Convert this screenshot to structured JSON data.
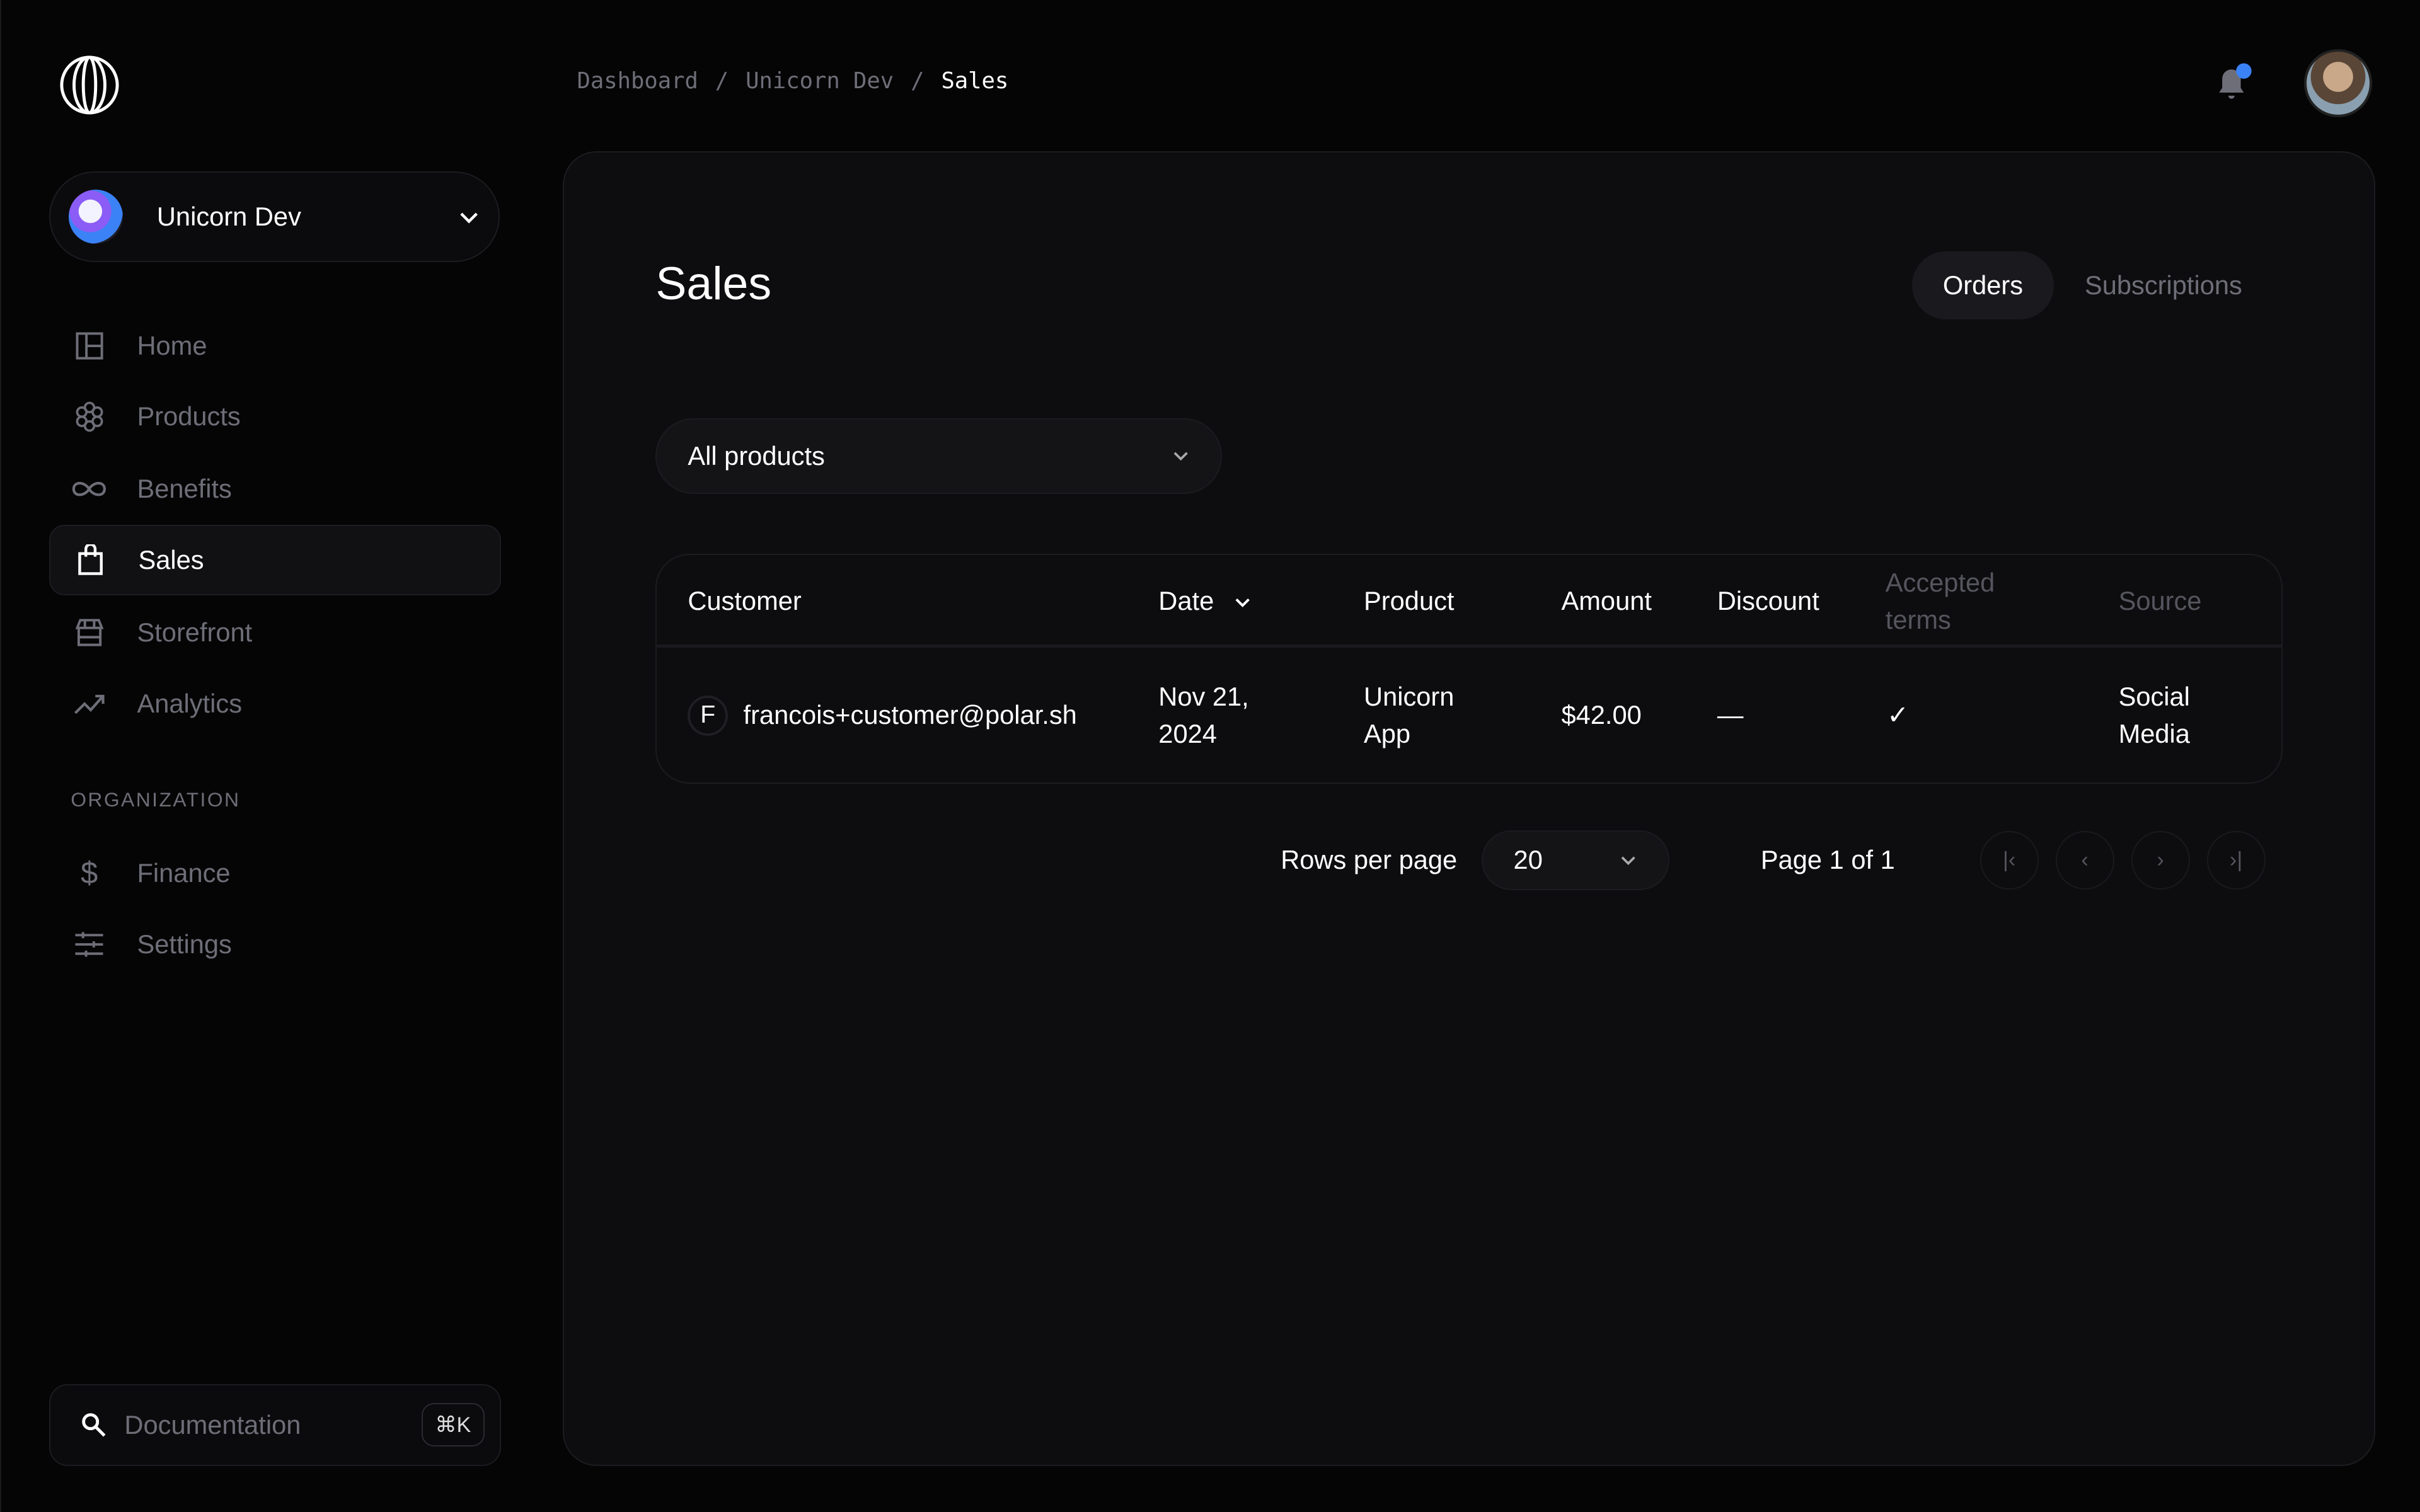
{
  "workspace": {
    "name": "Unicorn Dev"
  },
  "nav": [
    {
      "label": "Home",
      "icon": "layout-icon"
    },
    {
      "label": "Products",
      "icon": "hexagon-icon"
    },
    {
      "label": "Benefits",
      "icon": "infinity-icon"
    },
    {
      "label": "Sales",
      "icon": "shopping-bag-icon",
      "active": true
    },
    {
      "label": "Storefront",
      "icon": "store-icon"
    },
    {
      "label": "Analytics",
      "icon": "trending-up-icon"
    }
  ],
  "org": {
    "heading": "ORGANIZATION",
    "items": [
      {
        "label": "Finance",
        "icon": "dollar-icon"
      },
      {
        "label": "Settings",
        "icon": "sliders-icon"
      }
    ]
  },
  "docs": {
    "placeholder": "Documentation",
    "shortcut": "⌘K"
  },
  "breadcrumb": [
    "Dashboard",
    "Unicorn Dev",
    "Sales"
  ],
  "breadcrumb_sep": "/",
  "page": {
    "title": "Sales",
    "tabs": [
      "Orders",
      "Subscriptions"
    ],
    "filter": "All products"
  },
  "table": {
    "headers": [
      "Customer",
      "Date",
      "Product",
      "Amount",
      "Discount",
      "Accepted terms",
      "Source"
    ],
    "rows": [
      {
        "initial": "F",
        "customer": "francois+customer@polar.sh",
        "date": "Nov 21, 2024",
        "product": "Unicorn App",
        "amount": "$42.00",
        "discount": "—",
        "accepted": "✓",
        "source": "Social Media"
      }
    ]
  },
  "pagination": {
    "rows_label": "Rows per page",
    "rows_value": "20",
    "page_label": "Page 1 of 1"
  },
  "colors": {
    "accent": "#3b82f6",
    "muted": "#6e6e78"
  }
}
